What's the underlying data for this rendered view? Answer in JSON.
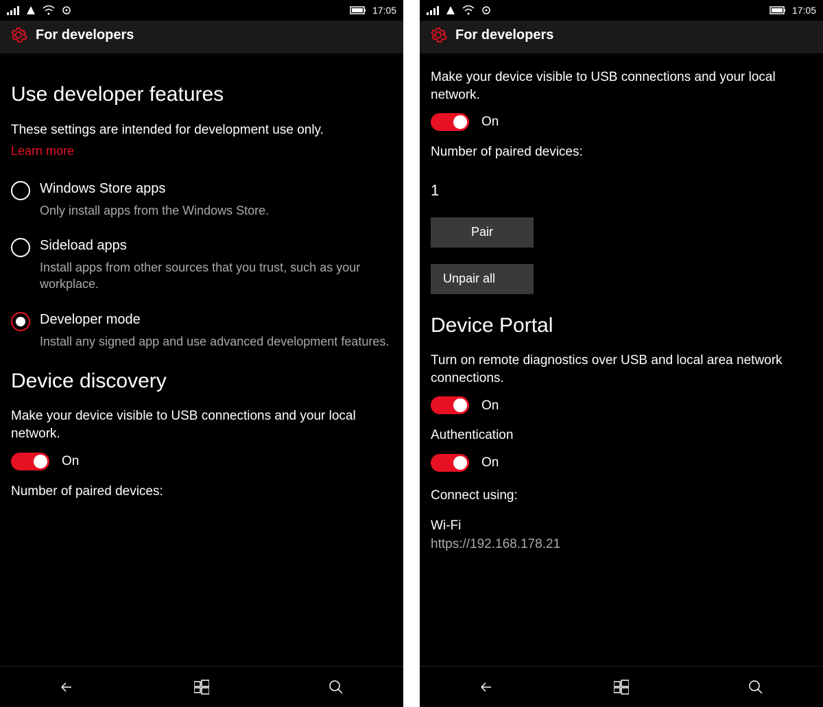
{
  "statusbar": {
    "time": "17:05"
  },
  "header": {
    "title": "For developers"
  },
  "left_screen": {
    "section1_title": "Use developer features",
    "section1_desc": "These settings are intended for development use only.",
    "learn_more": "Learn more",
    "radio": [
      {
        "label": "Windows Store apps",
        "desc": "Only install apps from the Windows Store."
      },
      {
        "label": "Sideload apps",
        "desc": "Install apps from other sources that you trust, such as your workplace."
      },
      {
        "label": "Developer mode",
        "desc": "Install any signed app and use advanced development features."
      }
    ],
    "section2_title": "Device discovery",
    "section2_desc": "Make your device visible to USB connections and your local network.",
    "toggle_label": "On",
    "paired_label": "Number of paired devices:"
  },
  "right_screen": {
    "discovery_desc": "Make your device visible to USB connections and your local network.",
    "discovery_toggle_label": "On",
    "paired_label": "Number of paired devices:",
    "paired_count": "1",
    "pair_btn": "Pair",
    "unpair_btn": "Unpair all",
    "portal_title": "Device Portal",
    "portal_desc": "Turn on remote diagnostics over USB and local area network connections.",
    "portal_toggle_label": "On",
    "auth_label": "Authentication",
    "auth_toggle_label": "On",
    "connect_label": "Connect using:",
    "connect_method": "Wi-Fi",
    "connect_url": "https://192.168.178.21"
  }
}
